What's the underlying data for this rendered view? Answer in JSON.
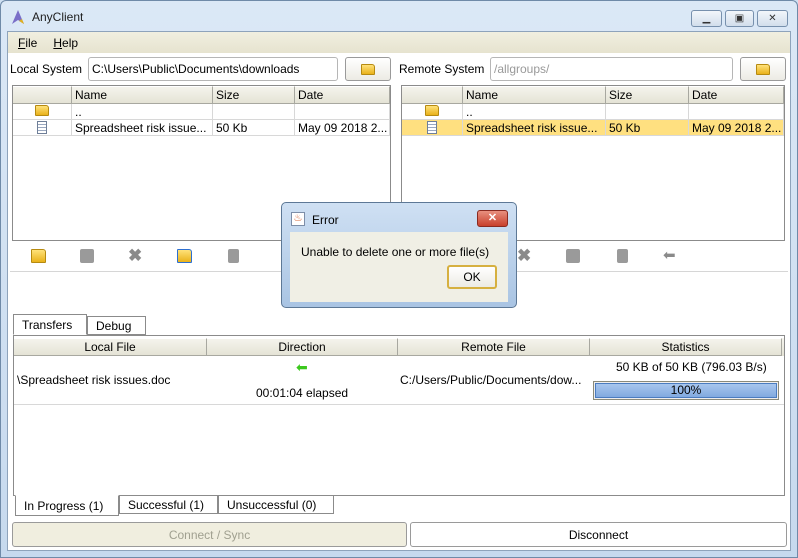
{
  "window": {
    "title": "AnyClient",
    "icon": "anyclient-logo-icon",
    "controls": [
      "minimize",
      "maximize",
      "close"
    ]
  },
  "menu": [
    {
      "label": "File",
      "mnemonic": "F",
      "rest": "ile"
    },
    {
      "label": "Help",
      "mnemonic": "H",
      "rest": "elp"
    }
  ],
  "local": {
    "label": "Local System",
    "path": "C:\\Users\\Public\\Documents\\downloads",
    "columns": [
      "",
      "Name",
      "Size",
      "Date"
    ],
    "rows": [
      {
        "icon": "folder-icon",
        "name": "..",
        "size": "",
        "date": ""
      },
      {
        "icon": "document-icon",
        "name": "Spreadsheet risk issue...",
        "size": "50 Kb",
        "date": "May 09 2018 2..."
      }
    ]
  },
  "remote": {
    "label": "Remote System",
    "path": "/allgroups/",
    "columns": [
      "",
      "Name",
      "Size",
      "Date"
    ],
    "rows": [
      {
        "icon": "folder-icon",
        "name": "..",
        "size": "",
        "date": ""
      },
      {
        "icon": "document-icon",
        "name": "Spreadsheet risk issue...",
        "size": "50 Kb",
        "date": "May 09 2018 2...",
        "selected": true
      }
    ]
  },
  "tabs": [
    {
      "label": "Transfers",
      "active": true
    },
    {
      "label": "Debug"
    }
  ],
  "transfers": {
    "columns": [
      "Local File",
      "Direction",
      "Remote File",
      "Statistics"
    ],
    "rows": [
      {
        "local": "\\Spreadsheet risk issues.doc",
        "direction": "download-arrow-left",
        "elapsed": "00:01:04 elapsed",
        "remote": "C:/Users/Public/Documents/dow...",
        "stats": "50 KB of 50 KB (796.03 B/s)",
        "progress": 100,
        "progress_label": "100%"
      }
    ]
  },
  "status_tabs": [
    {
      "label": "In Progress (1)",
      "active": true
    },
    {
      "label": "Successful (1)"
    },
    {
      "label": "Unsuccessful (0)"
    }
  ],
  "buttons": {
    "connect": "Connect / Sync",
    "disconnect": "Disconnect"
  },
  "dialog": {
    "title": "Error",
    "message": "Unable to delete one or more file(s)",
    "ok": "OK"
  },
  "colors": {
    "selection": "#ffe080",
    "progress": "#8fb4e3",
    "arrow": "#3cc81e"
  }
}
